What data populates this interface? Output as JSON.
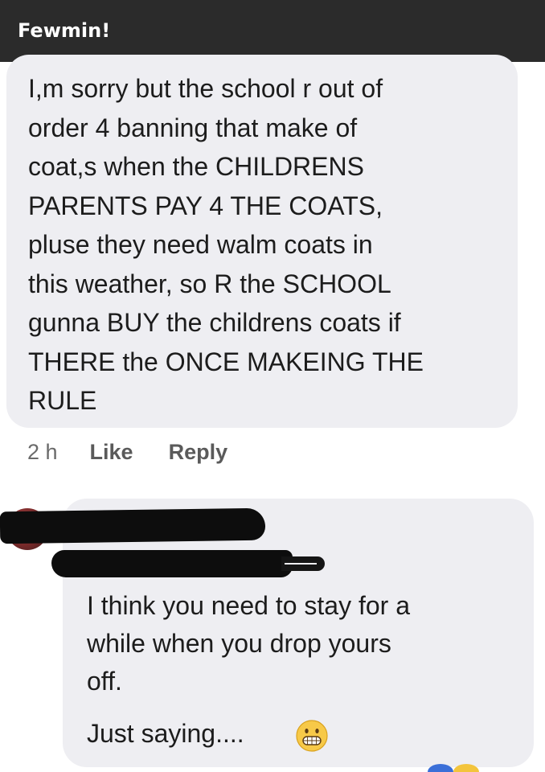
{
  "caption": {
    "text": "Fewmin!"
  },
  "comment_1": {
    "text": "I,m sorry but the school r out of\norder 4 banning that make of\ncoat,s when the CHILDRENS\nPARENTS PAY 4 THE COATS,\npluse they need walm coats in\nthis weather, so R the SCHOOL\ngunna BUY the childrens coats if\nTHERE the ONCE MAKEING THE\nRULE",
    "actions": {
      "time": "2 h",
      "like": "Like",
      "reply": "Reply"
    }
  },
  "comment_2": {
    "text": "I think you need to stay for a\nwhile when you drop yours\noff.",
    "signoff": "Just saying....",
    "emoji": "grinning-face-emoji"
  },
  "colors": {
    "caption_bar": "#2b2b2b",
    "bubble": "#eeeef2",
    "text": "#1c1c1c",
    "redaction": "#0d0d0d"
  }
}
